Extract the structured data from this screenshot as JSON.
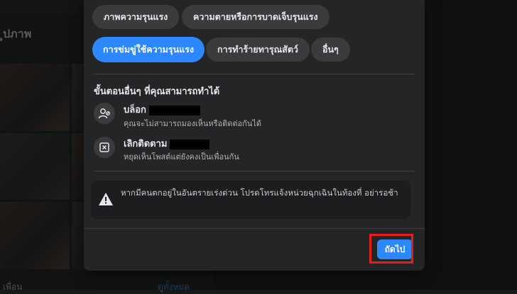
{
  "background": {
    "section_title": "ูปภาพ",
    "bottom_left": "เพื่อน",
    "bottom_link": "ดูทั้งหมด"
  },
  "dialog": {
    "chips_row1": [
      {
        "label": "ภาพความรุนแรง",
        "selected": false
      },
      {
        "label": "ความตายหรือการบาดเจ็บรุนแรง",
        "selected": false
      }
    ],
    "chips_row2": [
      {
        "label": "การข่มขู่ใช้ความรุนแรง",
        "selected": true
      },
      {
        "label": "การทำร้ายทารุณสัตว์",
        "selected": false
      },
      {
        "label": "อื่นๆ",
        "selected": false
      }
    ],
    "other_steps_title": "ขั้นตอนอื่นๆ ที่คุณสามารถทำได้",
    "options": [
      {
        "icon": "block-user-icon",
        "title": "บล็อก",
        "desc": "คุณจะไม่สามารถมองเห็นหรือติดต่อกันได้"
      },
      {
        "icon": "unfollow-icon",
        "title": "เลิกติดตาม",
        "desc": "หยุดเห็นโพสต์แต่ยังคงเป็นเพื่อนกัน"
      }
    ],
    "warning_text": "หากมีคนตกอยู่ในอันตรายเร่งด่วน โปรดโทรแจ้งหน่วยฉุกเฉินในท้องที่ อย่ารอช้า",
    "next_label": "ถัดไป"
  },
  "colors": {
    "accent": "#2d88ff",
    "highlight": "#e61e14",
    "dialog_bg": "#242526"
  }
}
